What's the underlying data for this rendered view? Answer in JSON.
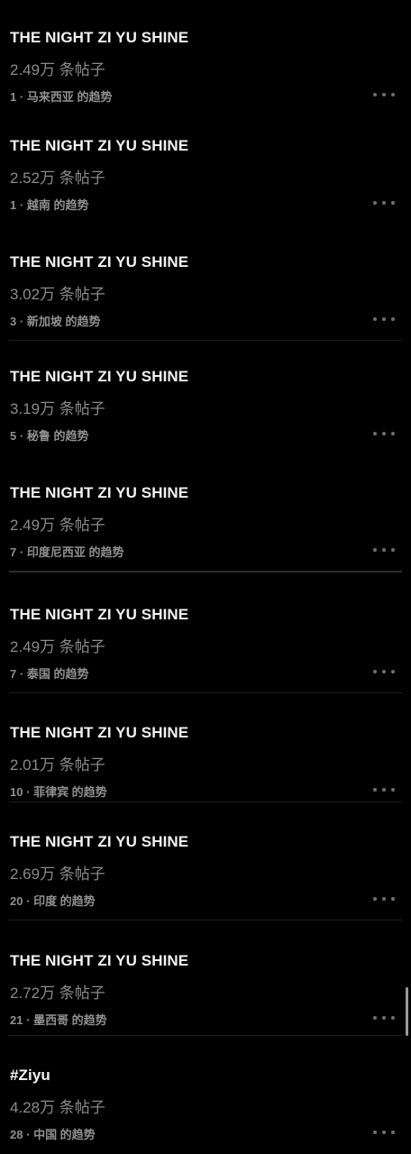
{
  "trends": [
    {
      "title": "THE NIGHT ZI YU SHINE",
      "posts": "2.49万 条帖子",
      "rank": "1",
      "sep": "·",
      "region": "马来西亚 的趋势"
    },
    {
      "title": "THE NIGHT ZI YU SHINE",
      "posts": "2.52万 条帖子",
      "rank": "1",
      "sep": "·",
      "region": "越南 的趋势"
    },
    {
      "title": "THE NIGHT ZI YU SHINE",
      "posts": "3.02万 条帖子",
      "rank": "3",
      "sep": "·",
      "region": "新加坡 的趋势"
    },
    {
      "title": "THE NIGHT ZI YU SHINE",
      "posts": "3.19万 条帖子",
      "rank": "5",
      "sep": "·",
      "region": "秘鲁 的趋势"
    },
    {
      "title": "THE NIGHT ZI YU SHINE",
      "posts": "2.49万 条帖子",
      "rank": "7",
      "sep": "·",
      "region": "印度尼西亚 的趋势"
    },
    {
      "title": "THE NIGHT ZI YU SHINE",
      "posts": "2.49万 条帖子",
      "rank": "7",
      "sep": "·",
      "region": "泰国 的趋势"
    },
    {
      "title": "THE NIGHT ZI YU SHINE",
      "posts": "2.01万 条帖子",
      "rank": "10",
      "sep": "·",
      "region": "菲律宾 的趋势"
    },
    {
      "title": "THE NIGHT ZI YU SHINE",
      "posts": "2.69万 条帖子",
      "rank": "20",
      "sep": "·",
      "region": "印度 的趋势"
    },
    {
      "title": "THE NIGHT ZI YU SHINE",
      "posts": "2.72万 条帖子",
      "rank": "21",
      "sep": "·",
      "region": "墨西哥 的趋势"
    },
    {
      "title": "#Ziyu",
      "posts": "4.28万 条帖子",
      "rank": "28",
      "sep": "·",
      "region": "中国 的趋势"
    }
  ],
  "icons": {
    "more": "more-options-icon"
  },
  "colors": {
    "background": "#000000",
    "title": "#f2f2f2",
    "secondary": "#8a8a8a"
  }
}
